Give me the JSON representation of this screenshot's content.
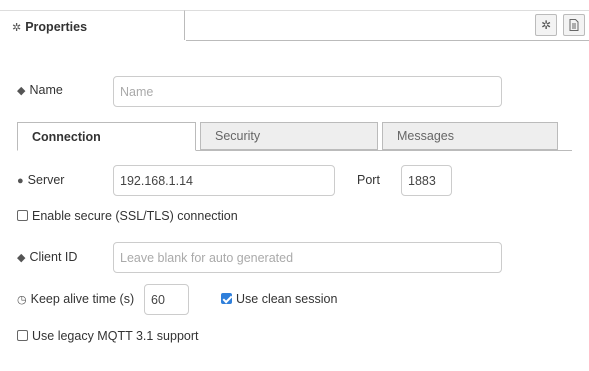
{
  "header": {
    "tab_label": "Properties",
    "settings_icon": "gear-icon",
    "description_icon": "document-icon"
  },
  "name_row": {
    "label": "Name",
    "placeholder": "Name",
    "value": ""
  },
  "tabs": [
    {
      "label": "Connection",
      "active": true
    },
    {
      "label": "Security",
      "active": false
    },
    {
      "label": "Messages",
      "active": false
    }
  ],
  "server_row": {
    "label": "Server",
    "value": "192.168.1.14",
    "port_label": "Port",
    "port_value": "1883"
  },
  "tls_checkbox": {
    "label": "Enable secure (SSL/TLS) connection",
    "checked": false
  },
  "client_id_row": {
    "label": "Client ID",
    "placeholder": "Leave blank for auto generated",
    "value": ""
  },
  "keepalive_row": {
    "label": "Keep alive time (s)",
    "value": "60"
  },
  "clean_session_checkbox": {
    "label": "Use clean session",
    "checked": true
  },
  "legacy_checkbox": {
    "label": "Use legacy MQTT 3.1 support",
    "checked": false
  },
  "colors": {
    "accent": "#2f7fdb",
    "border": "#bbbbbb",
    "inactive_tab": "#eeeeee"
  }
}
